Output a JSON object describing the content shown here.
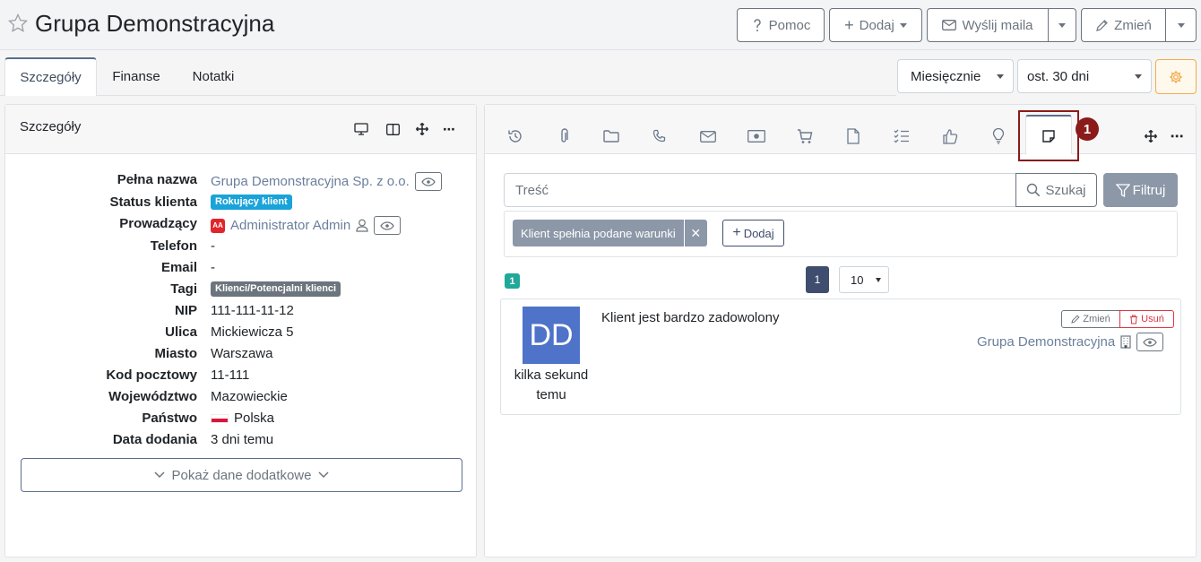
{
  "header": {
    "title": "Grupa Demonstracyjna",
    "help_label": "Pomoc",
    "add_label": "Dodaj",
    "send_mail_label": "Wyślij maila",
    "change_label": "Zmień"
  },
  "tabs": [
    {
      "label": "Szczegóły",
      "active": true
    },
    {
      "label": "Finanse",
      "active": false
    },
    {
      "label": "Notatki",
      "active": false
    }
  ],
  "filters": {
    "period": "Miesięcznie",
    "range": "ost. 30 dni"
  },
  "details": {
    "title": "Szczegóły",
    "fields": [
      {
        "label": "Pełna nazwa",
        "value": "Grupa Demonstracyjna Sp. z o.o."
      },
      {
        "label": "Status klienta",
        "value": "Rokujący klient"
      },
      {
        "label": "Prowadzący",
        "value": "Administrator Admin",
        "initials": "AA"
      },
      {
        "label": "Telefon",
        "value": "-"
      },
      {
        "label": "Email",
        "value": "-"
      },
      {
        "label": "Tagi",
        "value": "Klienci/Potencjalni klienci"
      },
      {
        "label": "NIP",
        "value": "111-111-11-12"
      },
      {
        "label": "Ulica",
        "value": "Mickiewicza 5"
      },
      {
        "label": "Miasto",
        "value": "Warszawa"
      },
      {
        "label": "Kod pocztowy",
        "value": "11-111"
      },
      {
        "label": "Województwo",
        "value": "Mazowieckie"
      },
      {
        "label": "Państwo",
        "value": "Polska"
      },
      {
        "label": "Data dodania",
        "value": "3 dni temu"
      }
    ],
    "more_label": "Pokaż dane dodatkowe"
  },
  "notes_panel": {
    "highlight_number": "1",
    "search_placeholder": "Treść",
    "search_label": "Szukaj",
    "filter_label": "Filtruj",
    "condition_chip": "Klient spełnia podane warunki",
    "add_condition_label": "Dodaj",
    "result_count": "1",
    "current_page": "1",
    "page_size": "10",
    "note": {
      "avatar_initials": "DD",
      "time": "kilka sekund temu",
      "text": "Klient jest bardzo zadowolony",
      "edit_label": "Zmień",
      "delete_label": "Usuń",
      "client": "Grupa Demonstracyjna"
    }
  },
  "colors": {
    "status_badge": "#1aa3d9",
    "tag_badge": "#6c757d",
    "accent": "#5a6e8c",
    "highlight": "#8b1a1a",
    "avatar": "#4e73c9"
  }
}
